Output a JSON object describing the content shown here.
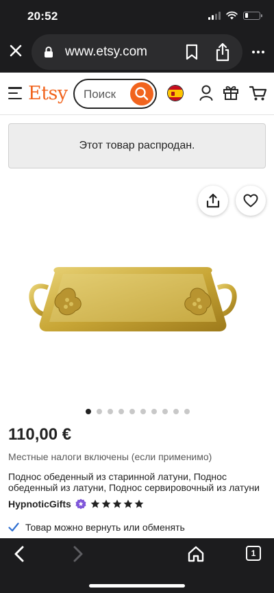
{
  "status_bar": {
    "time": "20:52"
  },
  "browser": {
    "url": "www.etsy.com",
    "icons": [
      "close-icon",
      "lock-icon",
      "bookmark-icon",
      "share-icon",
      "more-icon"
    ]
  },
  "header": {
    "logo": "Etsy",
    "search_placeholder": "Поиск",
    "icons": [
      "menu-icon",
      "search-icon",
      "spain-flag-icon",
      "user-icon",
      "gift-icon",
      "cart-icon"
    ]
  },
  "banner": {
    "text": "Этот товар распродан."
  },
  "gallery": {
    "image_count": 10,
    "active_index": 0
  },
  "product": {
    "price": "110,00 €",
    "tax_note": "Местные налоги включены (если применимо)",
    "title": "Поднос обеденный из старинной латуни, Поднос обеденный из латуни, Поднос сервировочный из латуни",
    "shop_name": "HypnoticGifts",
    "rating": 5,
    "returns_text": "Товар можно вернуть или обменять"
  },
  "colors": {
    "brand": "#f1641e",
    "chrome": "#1c1c1e",
    "star": "#222222",
    "check": "#2f6fd1",
    "badge": "#7f56d9"
  },
  "toolbar": {
    "tabs_count": "1"
  }
}
